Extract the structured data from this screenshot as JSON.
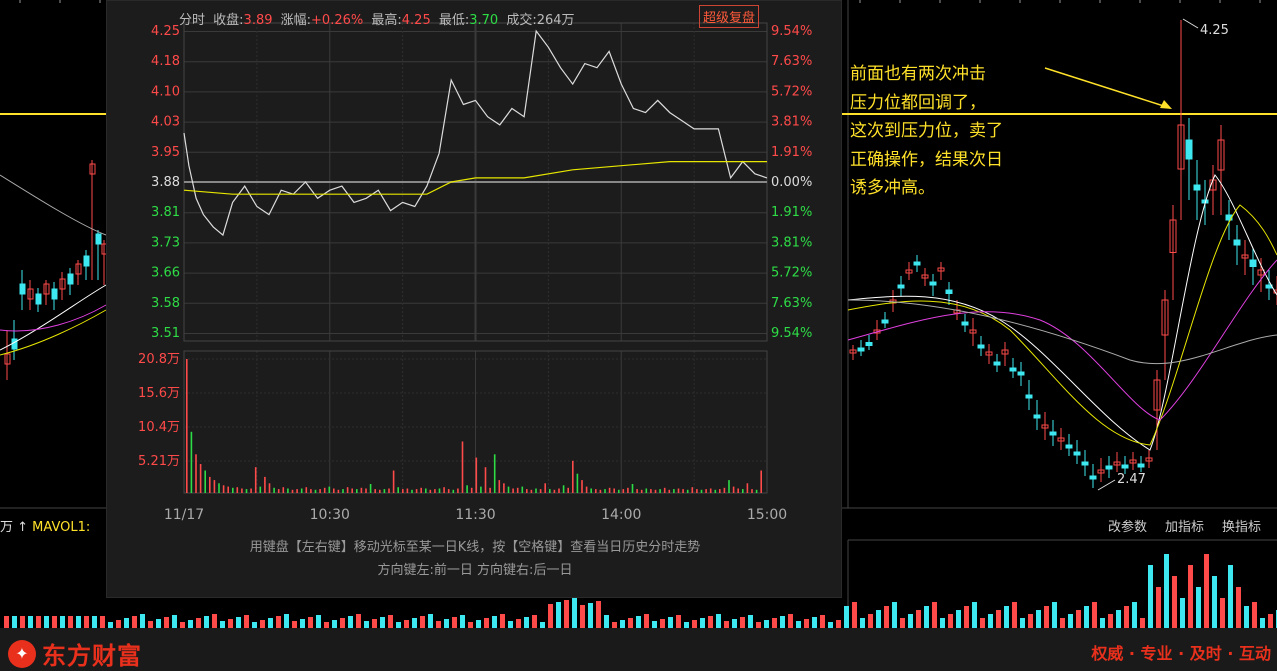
{
  "header": {
    "mode": "分时",
    "close_label": "收盘:",
    "close_value": "3.89",
    "change_label": "涨幅:",
    "change_value": "+0.26%",
    "high_label": "最高:",
    "high_value": "4.25",
    "low_label": "最低:",
    "low_value": "3.70",
    "volume_label": "成交:",
    "volume_value": "264万",
    "fuquan_button": "超级复盘"
  },
  "hints": {
    "line1": "用键盘【左右键】移动光标至某一日K线，按【空格键】查看当日历史分时走势",
    "line2": "方向键左:前一日  方向键右:后一日"
  },
  "annotation": {
    "lines": [
      "前面也有两次冲击",
      "压力位都回调了，",
      "这次到压力位，卖了",
      "正确操作，结果次日",
      "诱多冲高。"
    ],
    "high_label": "4.25",
    "low_label": "2.47"
  },
  "kline_buttons": {
    "params": "改参数",
    "add": "加指标",
    "swap": "换指标"
  },
  "mavol_label": {
    "prefix": "万 ↑",
    "name": "MAVOL1:"
  },
  "footer": {
    "brand": "东方财富",
    "slogan": "权威 · 专业 · 及时 · 互动"
  },
  "colors": {
    "up": "#ff4a4a",
    "down": "#2edc46",
    "avg_line": "#e6e600",
    "price_line": "#dcdcdc",
    "annotation": "#ffe12a",
    "brand": "#e8301c"
  },
  "chart_data": {
    "type": "line",
    "date": "11/17",
    "x_ticks": [
      "11/17",
      "10:30",
      "11:30",
      "14:00",
      "15:00"
    ],
    "price_ticks_left": [
      "4.25",
      "4.18",
      "4.10",
      "4.03",
      "3.95",
      "3.88",
      "3.81",
      "3.73",
      "3.66",
      "3.58",
      "3.51"
    ],
    "pct_ticks_right": [
      "9.54%",
      "7.63%",
      "5.72%",
      "3.81%",
      "1.91%",
      "0.00%",
      "1.91%",
      "3.81%",
      "5.72%",
      "7.63%",
      "9.54%"
    ],
    "prev_close": 3.88,
    "ylim": [
      3.51,
      4.25
    ],
    "volume_ticks": [
      "20.8万",
      "15.6万",
      "10.4万",
      "5.21万"
    ],
    "volume_ylim": [
      0,
      20.8
    ],
    "series": [
      {
        "x": [
          0,
          2,
          5,
          8,
          12,
          16,
          20,
          25,
          30,
          35,
          40,
          45,
          50,
          55,
          60,
          65,
          70,
          75,
          80,
          85,
          90,
          95,
          100,
          105,
          110,
          115,
          120,
          125,
          130,
          135,
          140,
          145,
          150,
          155,
          160,
          165,
          170,
          175,
          180,
          185,
          190,
          195,
          200,
          205,
          210,
          215,
          220,
          225,
          230,
          235,
          240
        ],
        "values": [
          4.0,
          3.92,
          3.84,
          3.8,
          3.77,
          3.75,
          3.83,
          3.87,
          3.82,
          3.8,
          3.86,
          3.85,
          3.88,
          3.84,
          3.86,
          3.87,
          3.83,
          3.84,
          3.86,
          3.81,
          3.83,
          3.82,
          3.87,
          3.95,
          4.13,
          4.07,
          4.08,
          4.04,
          4.02,
          4.06,
          4.04,
          4.25,
          4.21,
          4.16,
          4.12,
          4.17,
          4.16,
          4.2,
          4.12,
          4.06,
          4.05,
          4.08,
          4.05,
          4.03,
          4.01,
          4.01,
          4.01,
          3.89,
          3.93,
          3.9,
          3.89
        ]
      },
      {
        "x": [
          0,
          20,
          40,
          60,
          80,
          100,
          110,
          120,
          140,
          160,
          180,
          200,
          220,
          240
        ],
        "values": [
          3.86,
          3.85,
          3.85,
          3.85,
          3.85,
          3.85,
          3.88,
          3.89,
          3.89,
          3.91,
          3.92,
          3.93,
          3.93,
          3.93
        ]
      }
    ],
    "volume": [
      20.8,
      9.5,
      6.0,
      4.5,
      3.5,
      2.5,
      2.0,
      1.5,
      1.2,
      1.0,
      0.8,
      0.9,
      0.7,
      0.6,
      0.7,
      4.0,
      1.0,
      2.5,
      1.5,
      0.8,
      0.6,
      0.9,
      0.7,
      0.5,
      0.6,
      0.7,
      0.9,
      0.6,
      0.5,
      0.6,
      0.8,
      1.0,
      0.7,
      0.5,
      0.6,
      0.9,
      0.7,
      0.6,
      0.8,
      0.7,
      1.4,
      0.6,
      0.5,
      0.6,
      0.7,
      3.5,
      0.9,
      0.6,
      0.7,
      0.5,
      0.6,
      0.8,
      0.7,
      0.5,
      0.6,
      0.7,
      0.9,
      0.6,
      0.5,
      0.7,
      8.0,
      1.2,
      0.8,
      5.5,
      1.0,
      4.0,
      0.8,
      6.0,
      2.0,
      1.5,
      1.0,
      0.7,
      0.8,
      1.0,
      0.6,
      0.5,
      0.7,
      0.6,
      1.5,
      0.6,
      0.5,
      0.7,
      1.2,
      0.8,
      5.0,
      3.0,
      2.0,
      1.0,
      0.7,
      0.6,
      0.5,
      0.6,
      0.8,
      0.7,
      0.5,
      0.6,
      0.8,
      1.4,
      0.6,
      0.5,
      0.7,
      0.6,
      0.5,
      0.6,
      0.8,
      0.5,
      0.6,
      0.7,
      0.6,
      0.5,
      0.9,
      0.6,
      0.5,
      0.6,
      0.7,
      0.5,
      0.6,
      0.8,
      2.0,
      1.0,
      0.7,
      0.6,
      1.5,
      0.6,
      0.5,
      3.5
    ]
  }
}
